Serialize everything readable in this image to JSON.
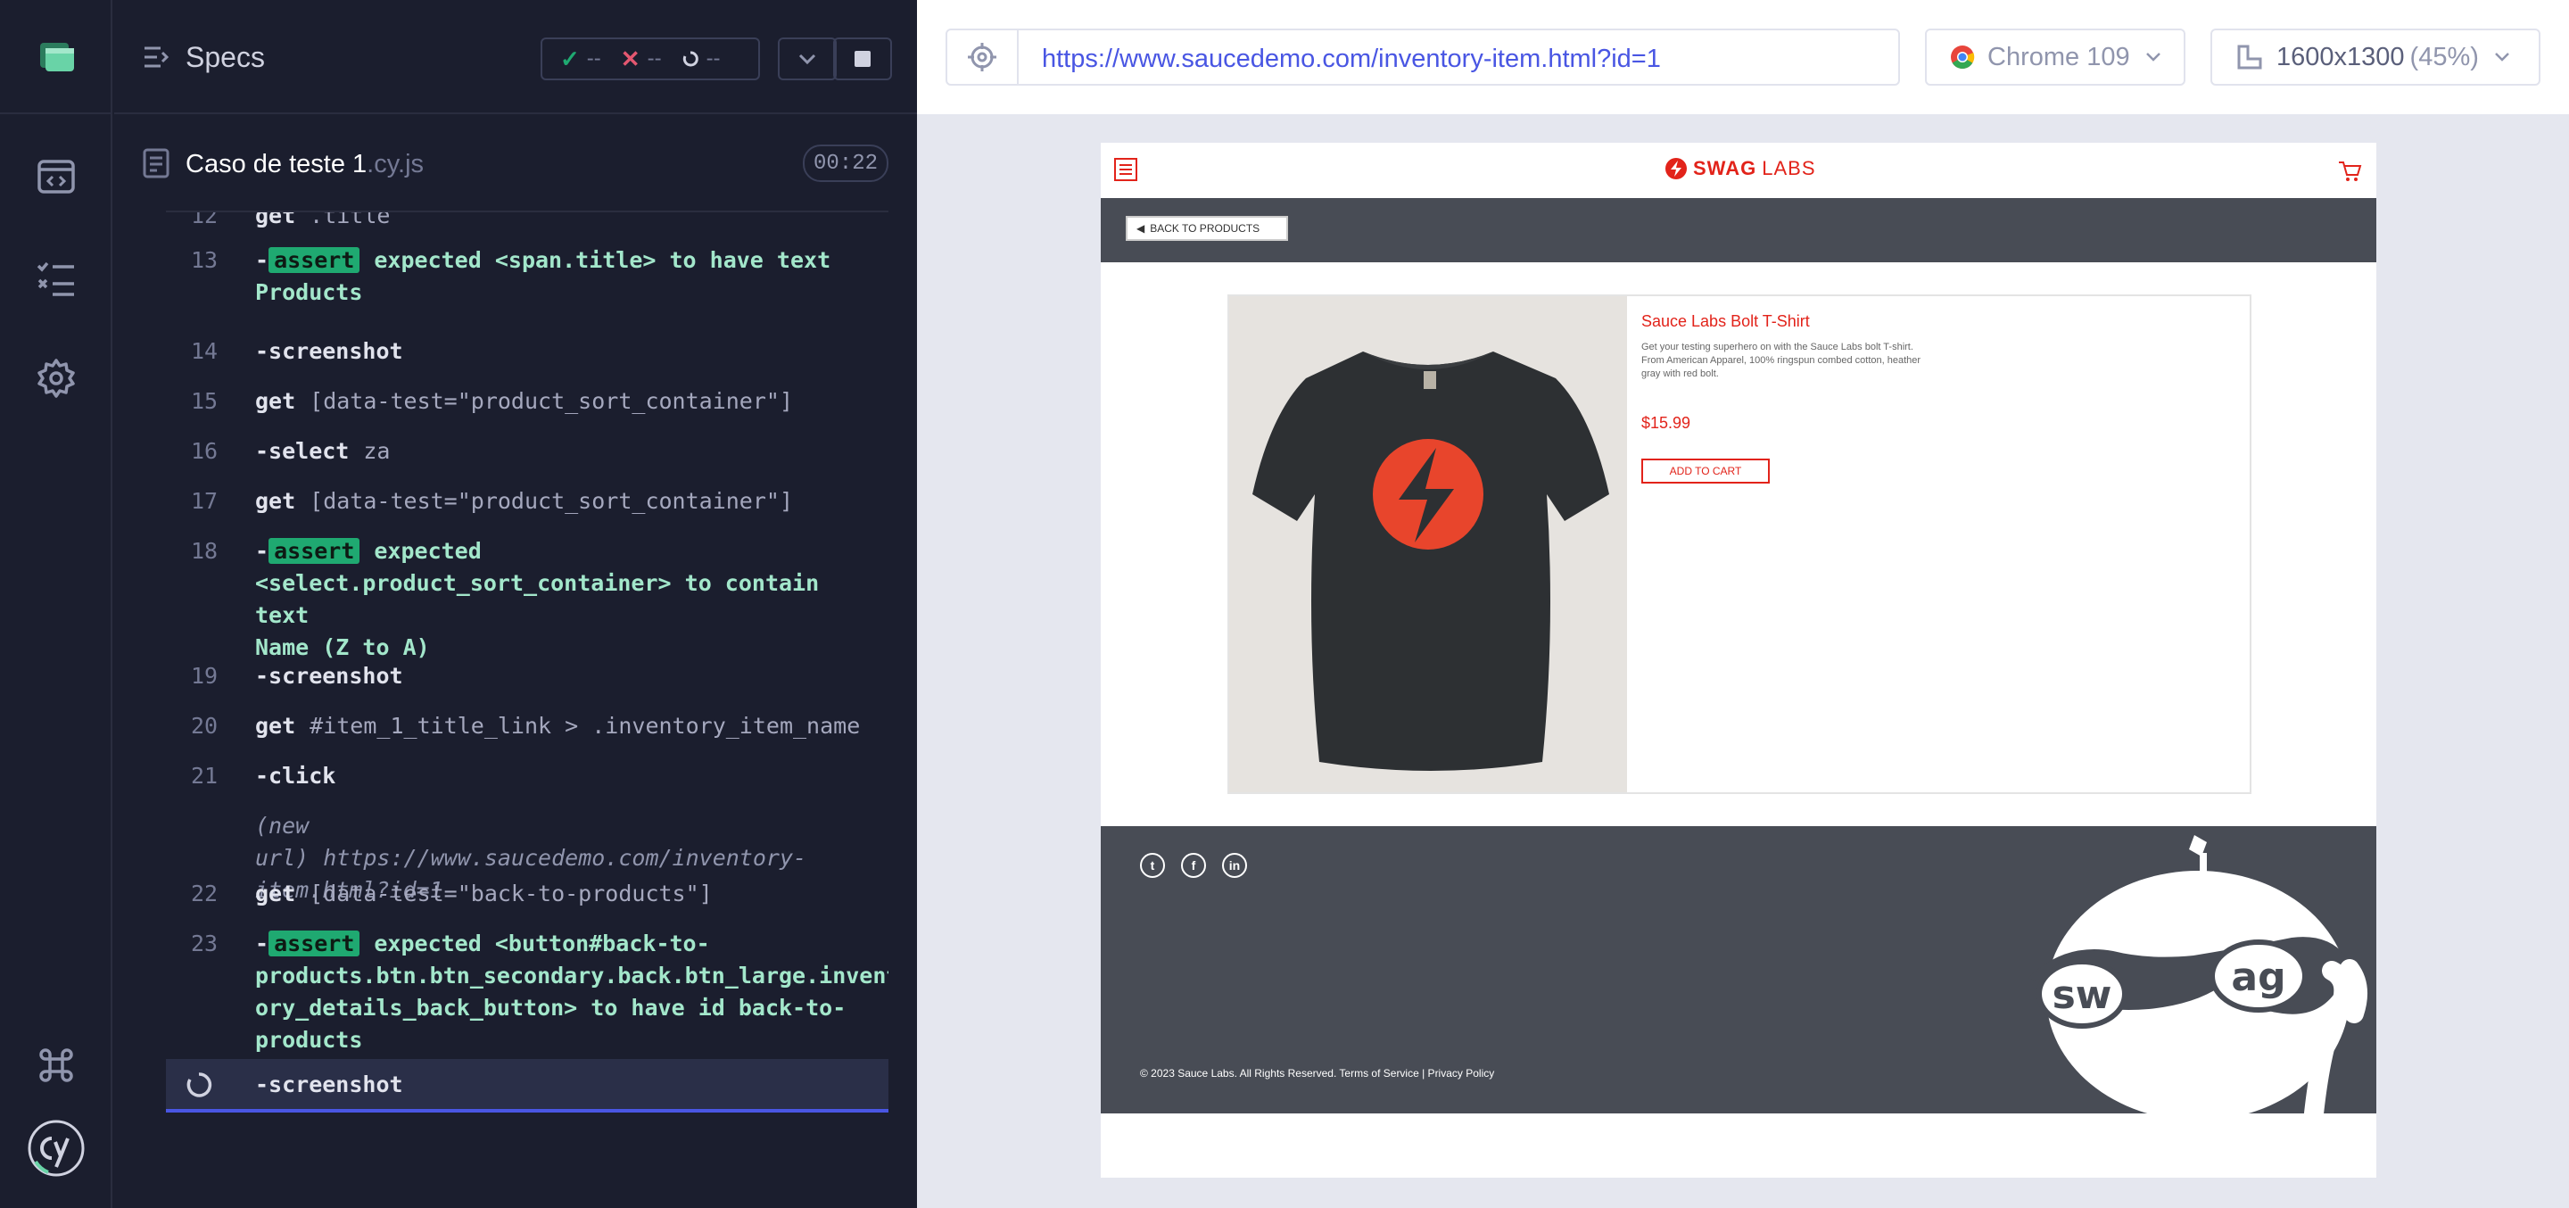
{
  "specs_panel": {
    "title": "Specs",
    "stats": {
      "passed": "--",
      "failed": "--",
      "pending": "--"
    },
    "spec_name": "Caso de teste 1",
    "spec_ext": ".cy.js",
    "duration": "00:22"
  },
  "command_log": [
    {
      "num": "12",
      "cmd": "get",
      "arg": ".title"
    },
    {
      "num": "13",
      "assert_lines": [
        "expected <span.title> to have text",
        "Products"
      ]
    },
    {
      "num": "14",
      "cmd": "-screenshot"
    },
    {
      "num": "15",
      "cmd": "get",
      "arg": "[data-test=\"product_sort_container\"]"
    },
    {
      "num": "16",
      "cmd": "-select",
      "arg": "za"
    },
    {
      "num": "17",
      "cmd": "get",
      "arg": "[data-test=\"product_sort_container\"]"
    },
    {
      "num": "18",
      "assert_lines": [
        "expected",
        "<select.product_sort_container> to contain text",
        "Name (Z to A)"
      ]
    },
    {
      "num": "19",
      "cmd": "-screenshot"
    },
    {
      "num": "20",
      "cmd": "get",
      "arg": "#item_1_title_link > .inventory_item_name"
    },
    {
      "num": "21",
      "cmd": "-click"
    },
    {
      "num": "",
      "newurl_label": "(new url)",
      "newurl_lines": [
        "https://www.saucedemo.com/inventory-",
        "item.html?id=1"
      ]
    },
    {
      "num": "22",
      "cmd": "get",
      "arg": "[data-test=\"back-to-products\"]"
    },
    {
      "num": "23",
      "assert_lines": [
        "expected <button#back-to-",
        "products.btn.btn_secondary.back.btn_large.invent",
        "ory_details_back_button> to have id back-to-",
        "products"
      ]
    },
    {
      "num": "",
      "cmd": "-screenshot",
      "active": true
    }
  ],
  "labels": {
    "assert": "assert",
    "expected": "expected"
  },
  "browser": {
    "url": "https://www.saucedemo.com/inventory-item.html?id=1",
    "browser_name": "Chrome 109",
    "viewport": "1600x1300",
    "scale": "(45%)"
  },
  "app": {
    "logo_swag": "SWAG",
    "logo_labs": "LABS",
    "back_button": "BACK TO PRODUCTS",
    "product_name": "Sauce Labs Bolt T-Shirt",
    "product_desc": "Get your testing superhero on with the Sauce Labs bolt T-shirt. From American Apparel, 100% ringspun combed cotton, heather gray with red bolt.",
    "price": "$15.99",
    "add_to_cart": "ADD TO CART",
    "footer_copy": "© 2023 Sauce Labs. All Rights Reserved. Terms of Service | Privacy Policy",
    "mascot_left": "sw",
    "mascot_right": "ag"
  },
  "colors": {
    "accent": "#4956e3",
    "passed": "#1fa971",
    "failed": "#e45770",
    "brand_red": "#e2231a"
  }
}
